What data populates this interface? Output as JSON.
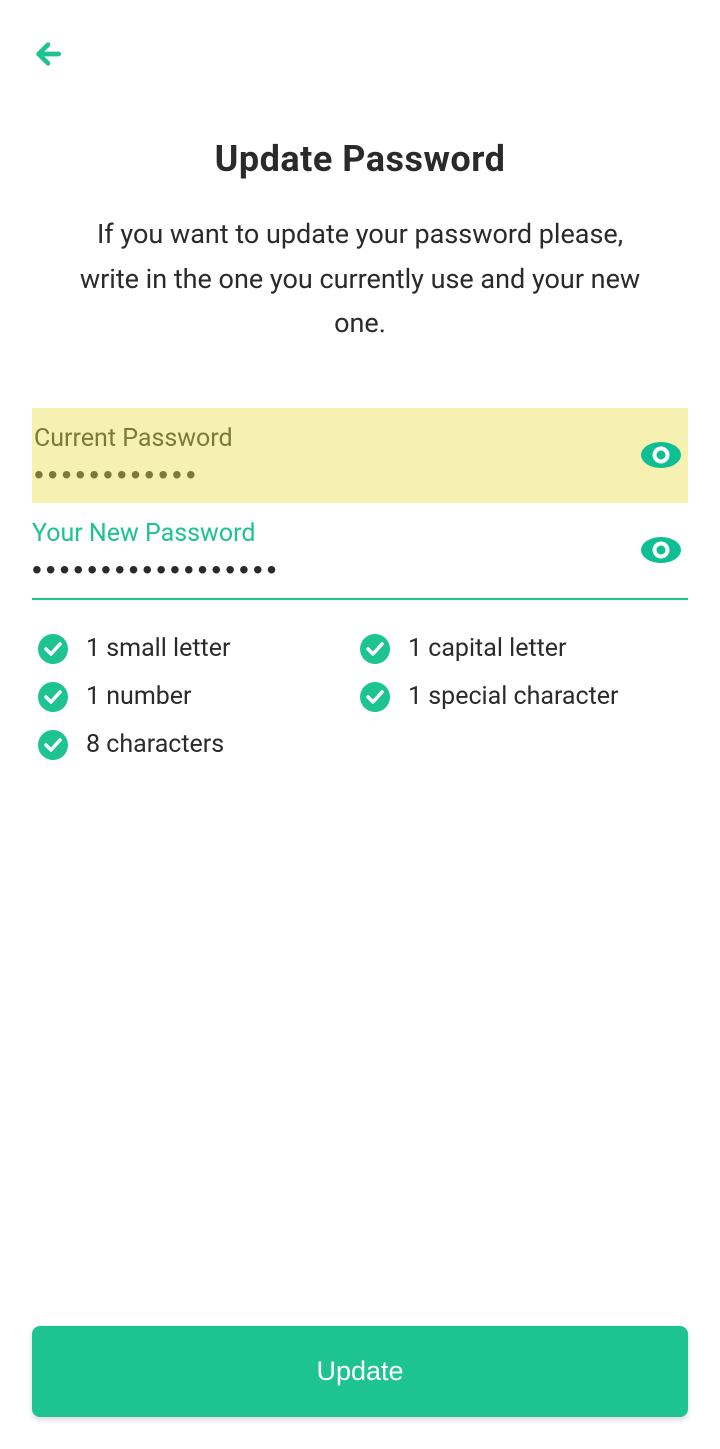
{
  "header": {
    "title": "Update Password",
    "subtitle": "If you want to update your password please, write in the one you currently use and your new one."
  },
  "fields": {
    "current": {
      "label": "Current Password",
      "value": "●●●●●●●●●●●●"
    },
    "new": {
      "label": "Your New Password",
      "value": "●●●●●●●●●●●●●●●●●●"
    }
  },
  "requirements": [
    {
      "label": "1 small letter",
      "met": true
    },
    {
      "label": "1 capital letter",
      "met": true
    },
    {
      "label": "1 number",
      "met": true
    },
    {
      "label": "1 special character",
      "met": true
    },
    {
      "label": "8 characters",
      "met": true
    }
  ],
  "actions": {
    "update": "Update"
  },
  "colors": {
    "accent": "#1dc391",
    "highlight": "#f7f1b1"
  }
}
